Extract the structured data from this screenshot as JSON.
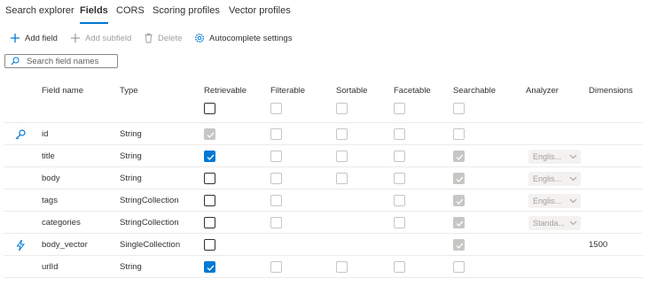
{
  "tabs": [
    {
      "label": "Search explorer"
    },
    {
      "label": "Fields"
    },
    {
      "label": "CORS"
    },
    {
      "label": "Scoring profiles"
    },
    {
      "label": "Vector profiles"
    }
  ],
  "active_tab": "Fields",
  "toolbar": {
    "add_field": "Add field",
    "add_subfield": "Add subfield",
    "delete": "Delete",
    "autocomplete": "Autocomplete settings"
  },
  "search": {
    "placeholder": "Search field names",
    "value": ""
  },
  "columns": {
    "field_name": "Field name",
    "type": "Type",
    "retrievable": "Retrievable",
    "filterable": "Filterable",
    "sortable": "Sortable",
    "facetable": "Facetable",
    "searchable": "Searchable",
    "analyzer": "Analyzer",
    "dimensions": "Dimensions"
  },
  "header_checkboxes": {
    "retrievable": "unchecked",
    "filterable": "disabled",
    "sortable": "disabled",
    "facetable": "disabled",
    "searchable": "disabled"
  },
  "accent_color": "#0078d4",
  "rows": [
    {
      "icon": "key-icon",
      "name": "id",
      "type": "String",
      "retrievable": "disabled-checked",
      "filterable": "disabled",
      "sortable": "disabled",
      "facetable": "disabled",
      "searchable": "disabled",
      "analyzer": "",
      "dimensions": ""
    },
    {
      "icon": "",
      "name": "title",
      "type": "String",
      "retrievable": "checked",
      "filterable": "disabled",
      "sortable": "disabled",
      "facetable": "disabled",
      "searchable": "disabled-checked",
      "analyzer": "Englis...",
      "dimensions": ""
    },
    {
      "icon": "",
      "name": "body",
      "type": "String",
      "retrievable": "unchecked",
      "filterable": "disabled",
      "sortable": "disabled",
      "facetable": "disabled",
      "searchable": "disabled-checked",
      "analyzer": "Englis...",
      "dimensions": ""
    },
    {
      "icon": "",
      "name": "tags",
      "type": "StringCollection",
      "retrievable": "unchecked",
      "filterable": "disabled",
      "sortable": "",
      "facetable": "disabled",
      "searchable": "disabled-checked",
      "analyzer": "Englis...",
      "dimensions": ""
    },
    {
      "icon": "",
      "name": "categories",
      "type": "StringCollection",
      "retrievable": "unchecked",
      "filterable": "disabled",
      "sortable": "",
      "facetable": "disabled",
      "searchable": "disabled-checked",
      "analyzer": "Standa...",
      "dimensions": ""
    },
    {
      "icon": "lightning-icon",
      "name": "body_vector",
      "type": "SingleCollection",
      "retrievable": "unchecked",
      "filterable": "",
      "sortable": "",
      "facetable": "",
      "searchable": "disabled-checked",
      "analyzer": "",
      "dimensions": "1500"
    },
    {
      "icon": "",
      "name": "urlId",
      "type": "String",
      "retrievable": "checked",
      "filterable": "disabled",
      "sortable": "disabled",
      "facetable": "disabled",
      "searchable": "disabled",
      "analyzer": "",
      "dimensions": ""
    }
  ]
}
